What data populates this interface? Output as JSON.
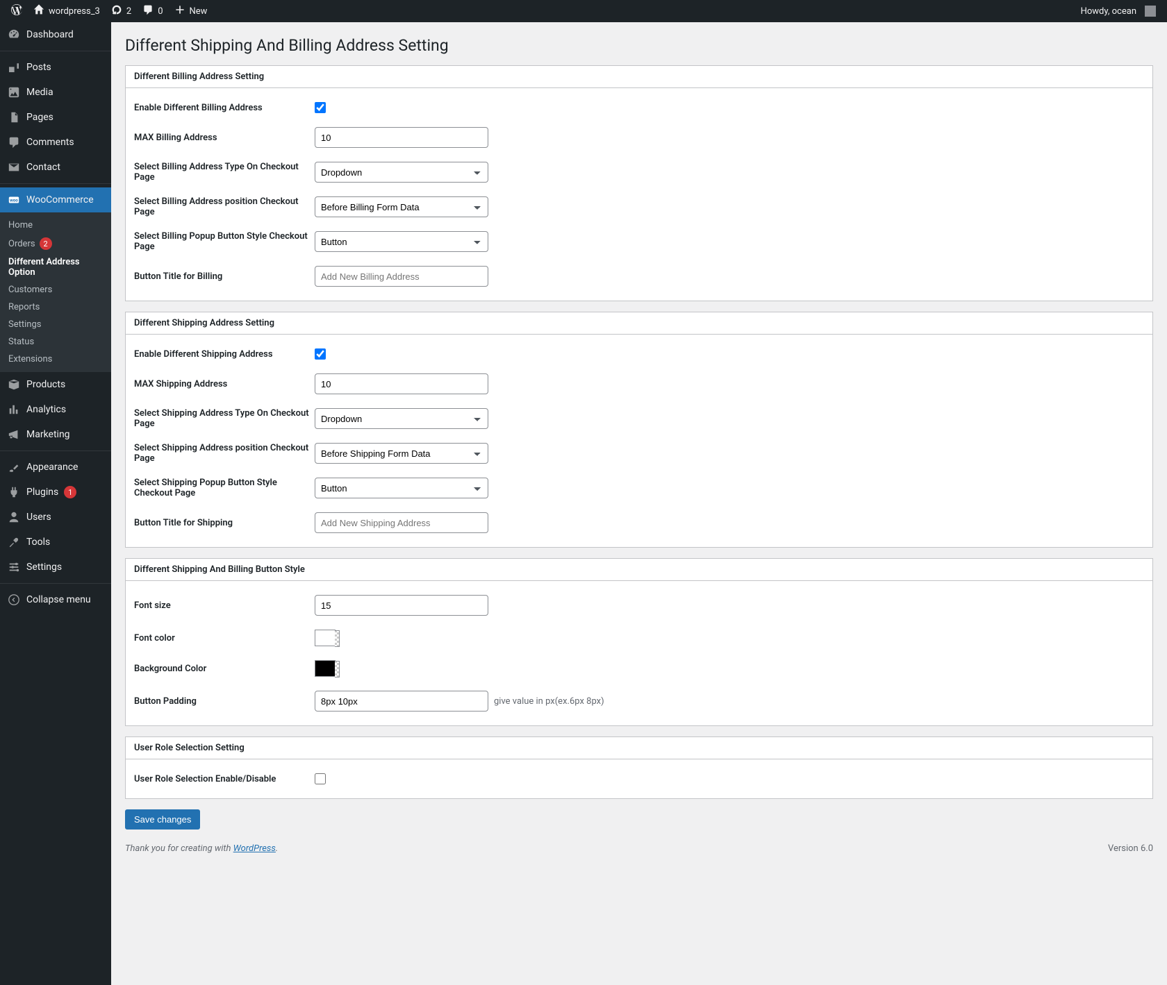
{
  "adminbar": {
    "site_name": "wordpress_3",
    "updates": "2",
    "comments": "0",
    "new_label": "New",
    "howdy": "Howdy, ocean"
  },
  "sidebar": {
    "dashboard": "Dashboard",
    "posts": "Posts",
    "media": "Media",
    "pages": "Pages",
    "comments": "Comments",
    "contact": "Contact",
    "woocommerce": "WooCommerce",
    "woo_sub": {
      "home": "Home",
      "orders": "Orders",
      "orders_count": "2",
      "diff_addr": "Different Address Option",
      "customers": "Customers",
      "reports": "Reports",
      "settings": "Settings",
      "status": "Status",
      "extensions": "Extensions"
    },
    "products": "Products",
    "analytics": "Analytics",
    "marketing": "Marketing",
    "appearance": "Appearance",
    "plugins": "Plugins",
    "plugins_count": "1",
    "users": "Users",
    "tools": "Tools",
    "settings": "Settings",
    "collapse": "Collapse menu"
  },
  "page_title": "Different Shipping And Billing Address Setting",
  "panels": {
    "billing": {
      "title": "Different Billing Address Setting",
      "enable_label": "Enable Different Billing Address",
      "max_label": "MAX Billing Address",
      "max_value": "10",
      "type_label": "Select Billing Address Type On Checkout Page",
      "type_value": "Dropdown",
      "position_label": "Select Billing Address position Checkout Page",
      "position_value": "Before Billing Form Data",
      "popup_style_label": "Select Billing Popup Button Style Checkout Page",
      "popup_style_value": "Button",
      "btn_title_label": "Button Title for Billing",
      "btn_title_placeholder": "Add New Billing Address"
    },
    "shipping": {
      "title": "Different Shipping Address Setting",
      "enable_label": "Enable Different Shipping Address",
      "max_label": "MAX Shipping Address",
      "max_value": "10",
      "type_label": "Select Shipping Address Type On Checkout Page",
      "type_value": "Dropdown",
      "position_label": "Select Shipping Address position Checkout Page",
      "position_value": "Before Shipping Form Data",
      "popup_style_label": "Select Shipping Popup Button Style Checkout Page",
      "popup_style_value": "Button",
      "btn_title_label": "Button Title for Shipping",
      "btn_title_placeholder": "Add New Shipping Address"
    },
    "style": {
      "title": "Different Shipping And Billing Button Style",
      "font_size_label": "Font size",
      "font_size_value": "15",
      "font_color_label": "Font color",
      "font_color_value": "#ffffff",
      "bg_color_label": "Background Color",
      "bg_color_value": "#000000",
      "padding_label": "Button Padding",
      "padding_value": "8px 10px",
      "padding_hint": "give value in px(ex.6px 8px)"
    },
    "role": {
      "title": "User Role Selection Setting",
      "enable_label": "User Role Selection Enable/Disable"
    }
  },
  "save_button": "Save changes",
  "footer": {
    "thanks_prefix": "Thank you for creating with ",
    "wp_link": "WordPress",
    "thanks_suffix": ".",
    "version": "Version 6.0"
  }
}
